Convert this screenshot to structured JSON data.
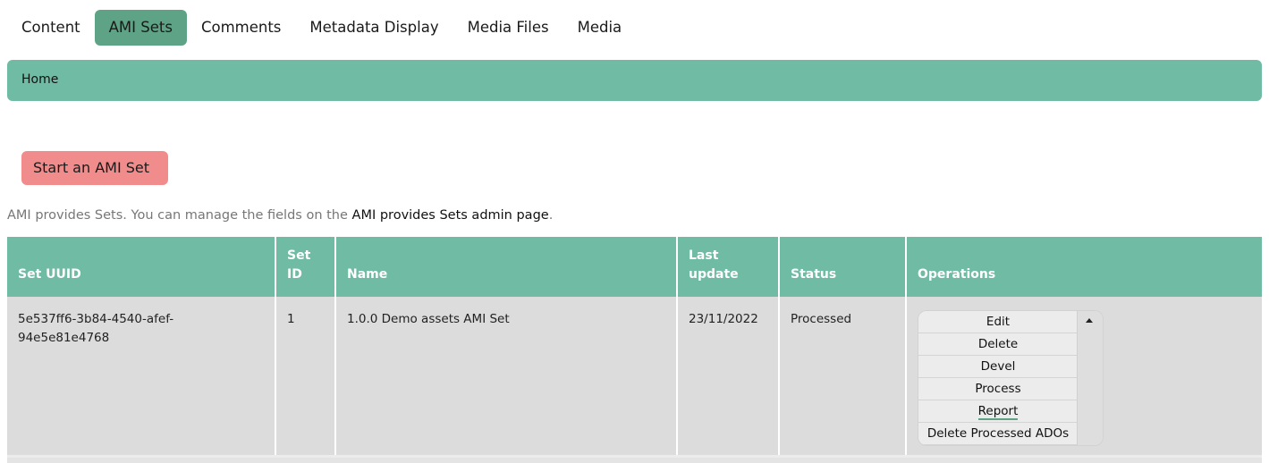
{
  "tabs": [
    {
      "label": "Content",
      "active": false
    },
    {
      "label": "AMI Sets",
      "active": true
    },
    {
      "label": "Comments",
      "active": false
    },
    {
      "label": "Metadata Display",
      "active": false
    },
    {
      "label": "Media Files",
      "active": false
    },
    {
      "label": "Media",
      "active": false
    }
  ],
  "breadcrumb": {
    "home": "Home"
  },
  "actions": {
    "start_label": "Start an AMI Set"
  },
  "description": {
    "prefix": "AMI provides Sets. You can manage the fields on the ",
    "link": "AMI provides Sets admin page",
    "suffix": "."
  },
  "table": {
    "headers": {
      "uuid": "Set UUID",
      "id_line1": "Set",
      "id_line2": "ID",
      "name": "Name",
      "updated_line1": "Last",
      "updated_line2": "update",
      "status": "Status",
      "operations": "Operations"
    },
    "rows": [
      {
        "uuid_line1": "5e537ff6-3b84-4540-afef-",
        "uuid_line2": "94e5e81e4768",
        "id": "1",
        "name": "1.0.0 Demo assets AMI Set",
        "updated": "23/11/2022",
        "status": "Processed",
        "operations": [
          "Edit",
          "Delete",
          "Devel",
          "Process",
          "Report",
          "Delete Processed ADOs"
        ]
      }
    ]
  },
  "colors": {
    "accent": "#70bba4",
    "active_tab": "#5fa386",
    "start_button": "#f08c8c",
    "row_bg": "#dcdcdc"
  },
  "icons": {
    "dropdown_toggle": "caret-up-icon"
  }
}
